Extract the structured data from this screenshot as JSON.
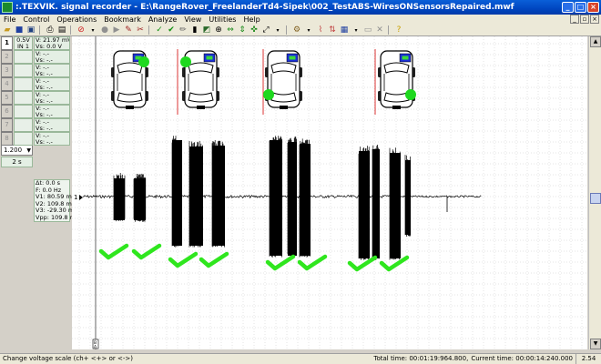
{
  "window": {
    "title": ":.TEXVIK. signal recorder - E:\\RangeRover_FreelanderTd4-Sipek\\002_TestABS-WiresONSensorsRepaired.mwf",
    "minimize": "_",
    "maximize": "□",
    "close": "×"
  },
  "menu": [
    "File",
    "Control",
    "Operations",
    "Bookmark",
    "Analyze",
    "View",
    "Utilities",
    "Help"
  ],
  "channels": [
    {
      "num": "1",
      "scale_top": "0.5V",
      "scale_bottom": "IN 1",
      "read1": "V: 21.97 mV",
      "read2": "Vs: 0.0 V",
      "active": true
    },
    {
      "num": "2",
      "scale_top": "",
      "scale_bottom": "",
      "read1": "V: -.-",
      "read2": "Vs: -.-",
      "active": false
    },
    {
      "num": "3",
      "scale_top": "",
      "scale_bottom": "",
      "read1": "V: -.-",
      "read2": "Vs: -.-",
      "active": false
    },
    {
      "num": "4",
      "scale_top": "",
      "scale_bottom": "",
      "read1": "V: -.-",
      "read2": "Vs: -.-",
      "active": false
    },
    {
      "num": "5",
      "scale_top": "",
      "scale_bottom": "",
      "read1": "V: -.-",
      "read2": "Vs: -.-",
      "active": false
    },
    {
      "num": "6",
      "scale_top": "",
      "scale_bottom": "",
      "read1": "V: -.-",
      "read2": "Vs: -.-",
      "active": false
    },
    {
      "num": "7",
      "scale_top": "",
      "scale_bottom": "",
      "read1": "V: -.-",
      "read2": "Vs: -.-",
      "active": false
    },
    {
      "num": "8",
      "scale_top": "",
      "scale_bottom": "",
      "read1": "V: -.-",
      "read2": "Vs: -.-",
      "active": false
    }
  ],
  "timebase": {
    "value": "1.200",
    "per_div": "2 s"
  },
  "measurements": {
    "dt": "Δt: 0.0 s",
    "f": "F: 0.0 Hz",
    "v1": "V1: 80.59 mV",
    "v2": "V2: 109.8 mV",
    "v3": "V3: -29.30 mV",
    "vpp": "Vpp: 109.8 mV"
  },
  "plot": {
    "channel_marker": "1",
    "cursor_label": "B\nA",
    "colors": {
      "signal": "#000000",
      "grid": "#c8c8c8",
      "check": "#2fe61e",
      "marker": "#d82020",
      "sensor": "#1ed81e"
    }
  },
  "status": {
    "hint": "Change voltage scale (ch+ <+> or <->)",
    "total_time": "Total time: 00:01:19:964.800,",
    "current_time": "Current time: 00:00:14:240.000",
    "zoom": "2.54"
  }
}
